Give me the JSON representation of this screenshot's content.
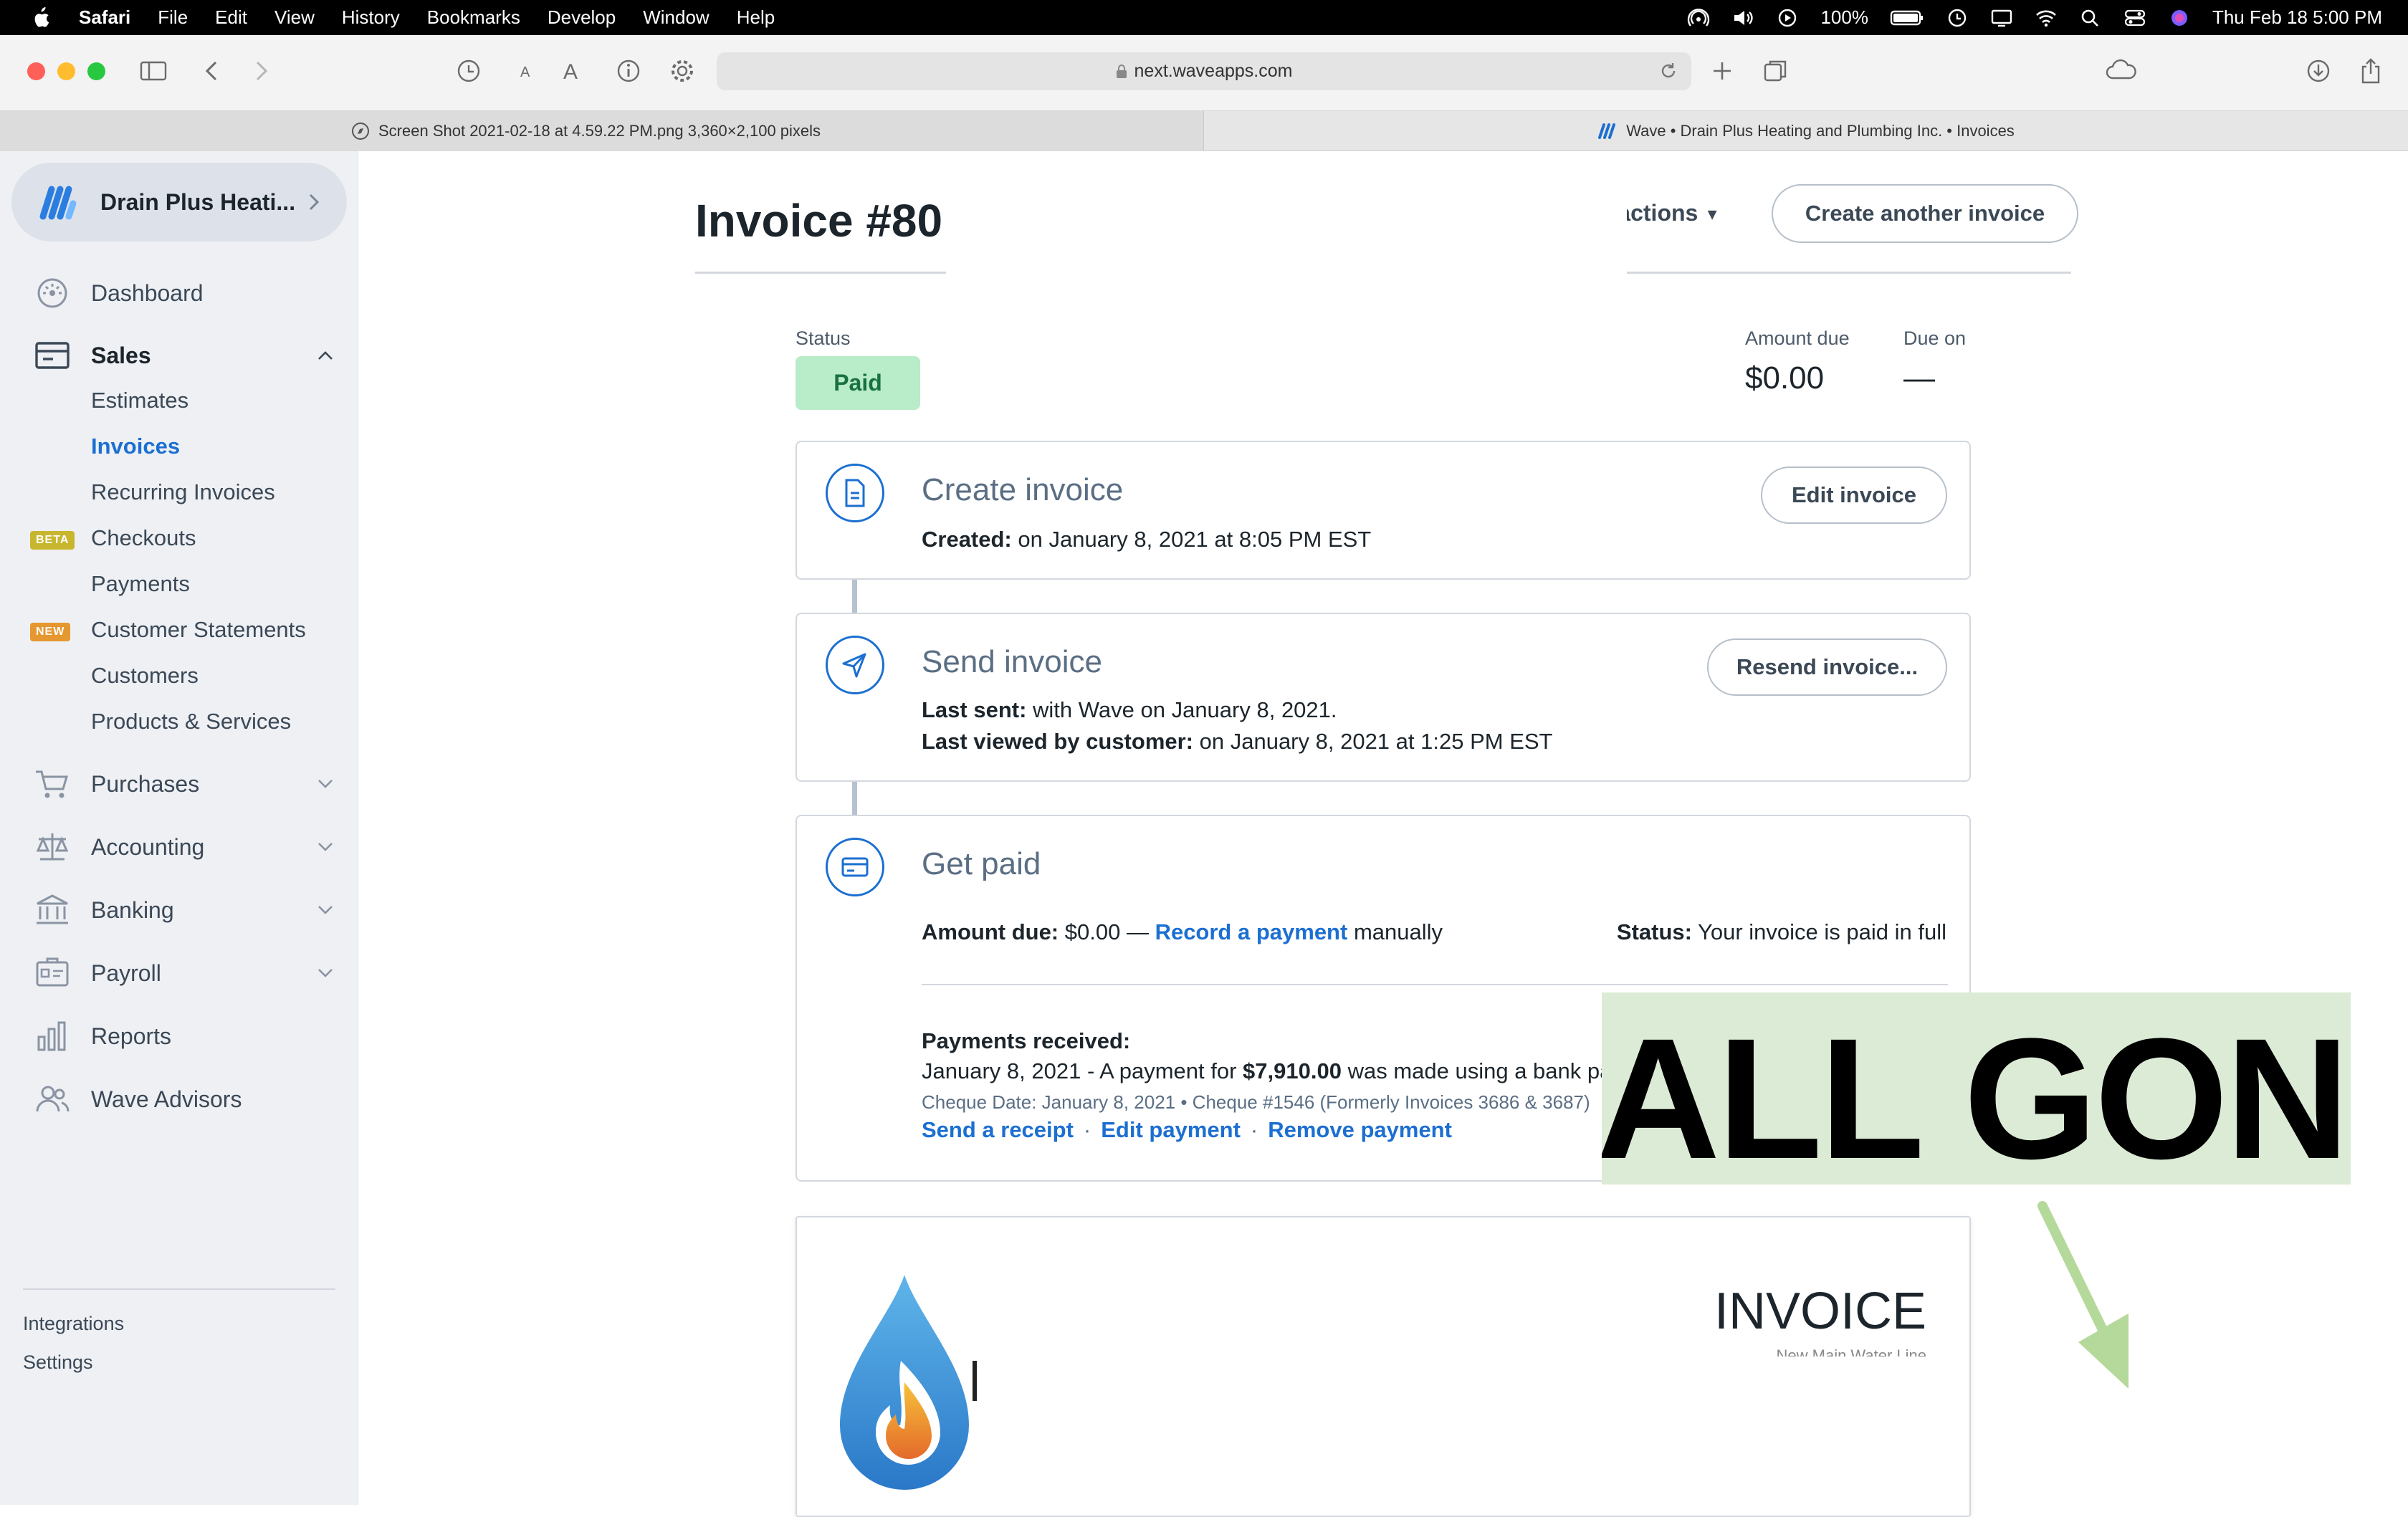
{
  "menubar": {
    "app": "Safari",
    "items": [
      "File",
      "Edit",
      "View",
      "History",
      "Bookmarks",
      "Develop",
      "Window",
      "Help"
    ],
    "battery": "100%",
    "clock": "Thu Feb 18  5:00 PM"
  },
  "browser": {
    "url": "next.waveapps.com",
    "tab1": "Screen Shot 2021-02-18 at 4.59.22 PM.png 3,360×2,100 pixels",
    "tab2": "Wave • Drain Plus Heating and Plumbing Inc. • Invoices"
  },
  "sidebar": {
    "business": "Drain Plus Heati...",
    "dashboard": "Dashboard",
    "sales": "Sales",
    "sales_items": [
      "Estimates",
      "Invoices",
      "Recurring Invoices",
      "Checkouts",
      "Payments",
      "Customer Statements",
      "Customers",
      "Products & Services"
    ],
    "beta_badge": "BETA",
    "new_badge": "NEW",
    "purchases": "Purchases",
    "accounting": "Accounting",
    "banking": "Banking",
    "payroll": "Payroll",
    "reports": "Reports",
    "advisors": "Wave Advisors",
    "integrations": "Integrations",
    "settings": "Settings"
  },
  "invoice": {
    "title": "Invoice #80",
    "more_actions": "More actions",
    "create_another": "Create another invoice",
    "status_label": "Status",
    "status": "Paid",
    "amount_due_label": "Amount due",
    "amount_due": "$0.00",
    "due_on_label": "Due on",
    "due_on": "—"
  },
  "create_card": {
    "title": "Create invoice",
    "button": "Edit invoice",
    "created_label": "Created:",
    "created_value": " on January 8, 2021 at 8:05 PM EST"
  },
  "send_card": {
    "title": "Send invoice",
    "button": "Resend invoice...",
    "last_sent_label": "Last sent:",
    "last_sent_value": " with Wave on January 8, 2021.",
    "last_viewed_label": "Last viewed by customer:",
    "last_viewed_value": " on January 8, 2021 at 1:25 PM EST"
  },
  "paid_card": {
    "title": "Get paid",
    "amount_due_label": "Amount due:",
    "amount_due_value": " $0.00 — ",
    "record_payment": "Record a payment",
    "manually": " manually",
    "status_label": "Status:",
    "status_value": " Your invoice is paid in full",
    "payments_received": "Payments received:",
    "payment_pre": "January 8, 2021 - A payment for ",
    "payment_amount": "$7,910.00",
    "payment_post": " was made using a bank payment.",
    "cheque": "Cheque Date: January 8, 2021 • Cheque #1546 (Formerly Invoices 3686 & 3687)",
    "send_receipt": "Send a receipt",
    "edit_payment": "Edit payment",
    "remove_payment": "Remove payment",
    "sep": "·"
  },
  "preview": {
    "heading": "INVOICE",
    "subheading": "New Main Water Line"
  },
  "overlay": {
    "text": "ALL GONE",
    "color": "#dcebd5",
    "arrow_color": "#b5d99a"
  }
}
